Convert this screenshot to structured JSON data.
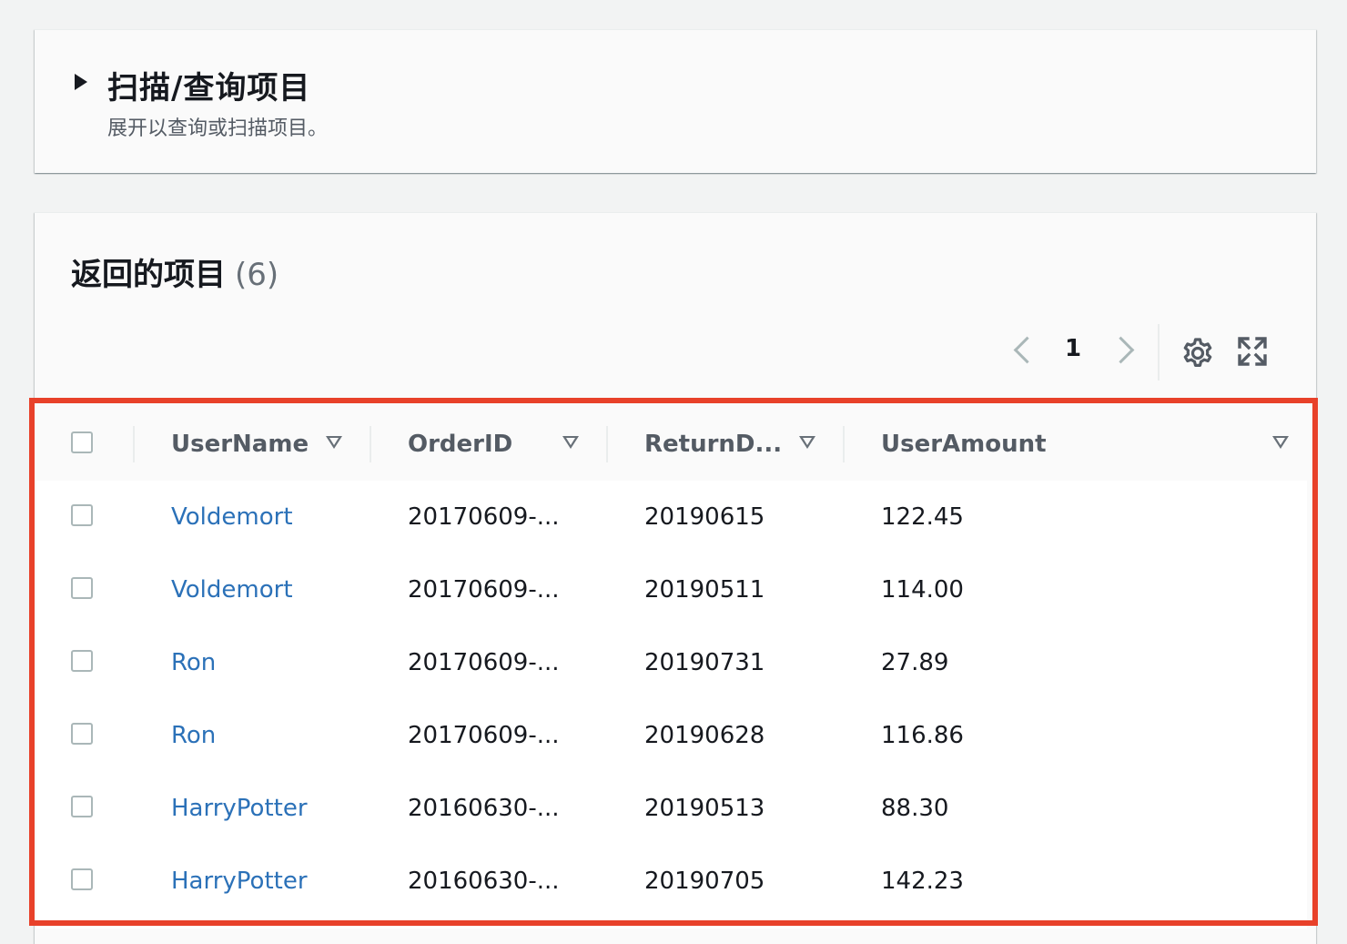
{
  "scan_panel": {
    "title": "扫描/查询项目",
    "description": "展开以查询或扫描项目。"
  },
  "results": {
    "title": "返回的项目",
    "count": "(6)",
    "pagination": {
      "current_page": "1"
    },
    "columns": [
      "UserName",
      "OrderID",
      "ReturnD...",
      "UserAmount"
    ],
    "rows": [
      {
        "username": "Voldemort",
        "order_id": "20170609-...",
        "return_date": "20190615",
        "user_amount": "122.45"
      },
      {
        "username": "Voldemort",
        "order_id": "20170609-...",
        "return_date": "20190511",
        "user_amount": "114.00"
      },
      {
        "username": "Ron",
        "order_id": "20170609-...",
        "return_date": "20190731",
        "user_amount": "27.89"
      },
      {
        "username": "Ron",
        "order_id": "20170609-...",
        "return_date": "20190628",
        "user_amount": "116.86"
      },
      {
        "username": "HarryPotter",
        "order_id": "20160630-...",
        "return_date": "20190513",
        "user_amount": "88.30"
      },
      {
        "username": "HarryPotter",
        "order_id": "20160630-...",
        "return_date": "20190705",
        "user_amount": "142.23"
      }
    ]
  },
  "icons": {
    "expand": "caret-right-icon",
    "prev": "chevron-left-icon",
    "next": "chevron-right-icon",
    "settings": "gear-icon",
    "fullscreen": "fullscreen-icon",
    "sort": "sort-down-icon"
  },
  "colors": {
    "link": "#2b71b8",
    "highlight": "#e8412a",
    "background": "#f2f3f3"
  }
}
